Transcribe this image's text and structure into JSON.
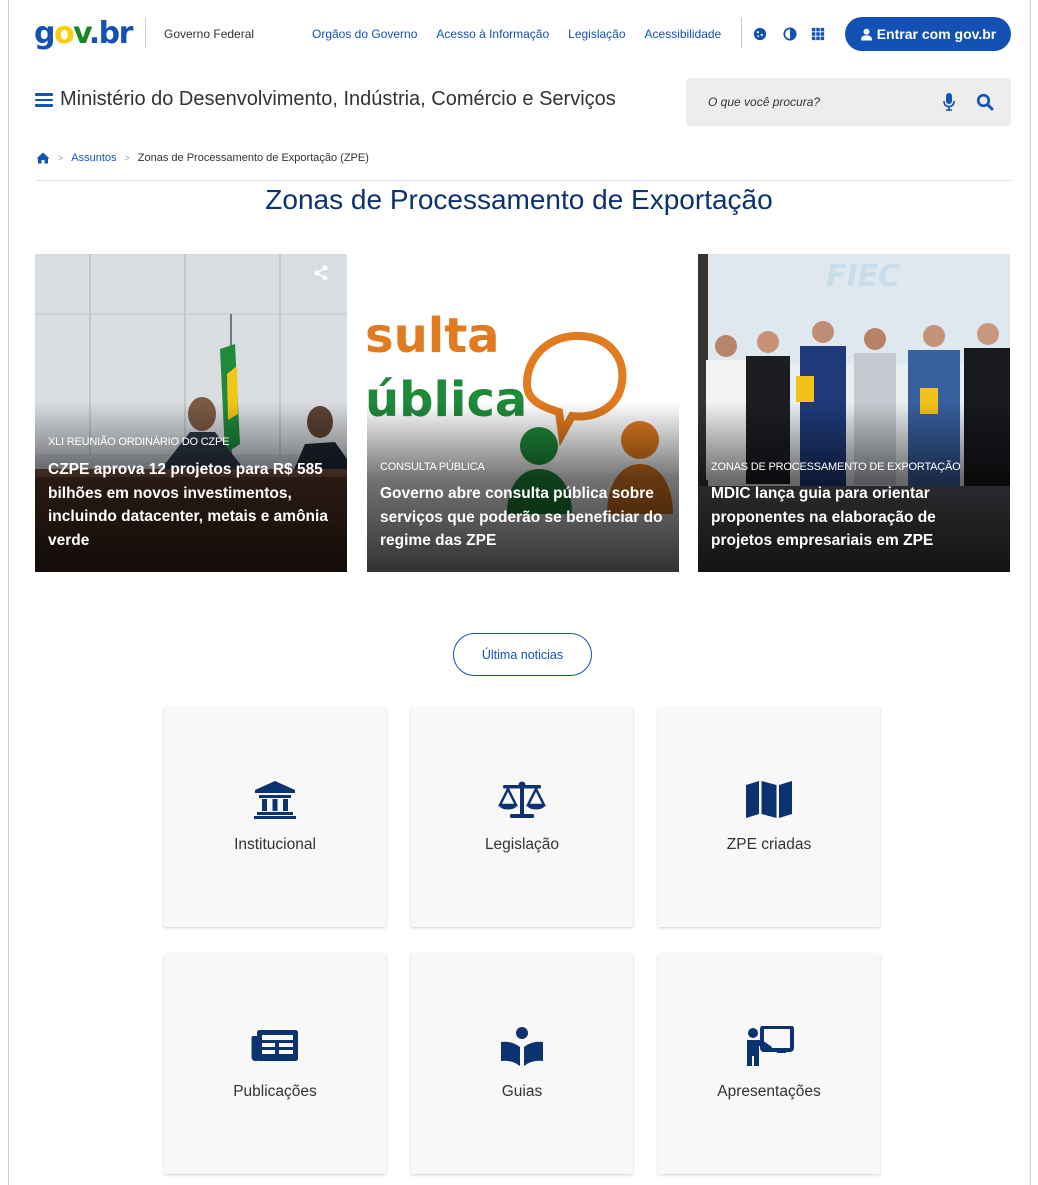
{
  "header": {
    "logo": {
      "g": "g",
      "o": "o",
      "v": "v",
      "dot": ".",
      "br": "br"
    },
    "gov_federal": "Governo Federal",
    "links": [
      "Orgãos do Governo",
      "Acesso à Informação",
      "Legislação",
      "Acessibilidade"
    ],
    "icons": [
      "cookie-icon",
      "contrast-icon",
      "apps-grid-icon"
    ],
    "login_label": "Entrar com gov.br",
    "ministry": "Ministério do Desenvolvimento, Indústria, Comércio e Serviços",
    "search_placeholder": "O que você procura?"
  },
  "breadcrumb": {
    "items": [
      "Assuntos",
      "Zonas de Processamento de Exportação (ZPE)"
    ]
  },
  "page_title": "Zonas de Processamento de Exportação",
  "news": [
    {
      "tag": "XLI REUNIÃO ORDINÁRIO DO CZPE",
      "headline": "CZPE aprova 12 projetos para R$ 585 bilhões em novos investimentos, incluindo datacenter, metais e amônia verde"
    },
    {
      "tag": "CONSULTA PÚBLICA",
      "headline": "Governo abre consulta pública sobre serviços que poderão se beneficiar do regime das ZPE",
      "image_text": {
        "line1": "sulta",
        "line2": "ública"
      }
    },
    {
      "tag": "ZONAS DE PROCESSAMENTO DE EXPORTAÇÃO",
      "headline": "MDIC lança guia para orientar proponentes na elaboração de projetos empresariais em ZPE",
      "image_text": {
        "logo": "FIEC"
      }
    }
  ],
  "latest_news_label": "Última noticias",
  "tiles": [
    {
      "label": "Institucional",
      "icon": "landmark-icon"
    },
    {
      "label": "Legislação",
      "icon": "balance-scale-icon"
    },
    {
      "label": "ZPE criadas",
      "icon": "map-icon"
    },
    {
      "label": "Publicações",
      "icon": "newspaper-icon"
    },
    {
      "label": "Guias",
      "icon": "book-reader-icon"
    },
    {
      "label": "Apresentações",
      "icon": "chalkboard-teacher-icon"
    }
  ],
  "colors": {
    "primary": "#1351b4",
    "title": "#0c326f",
    "yellow": "#ffcd07",
    "green": "#168821"
  }
}
